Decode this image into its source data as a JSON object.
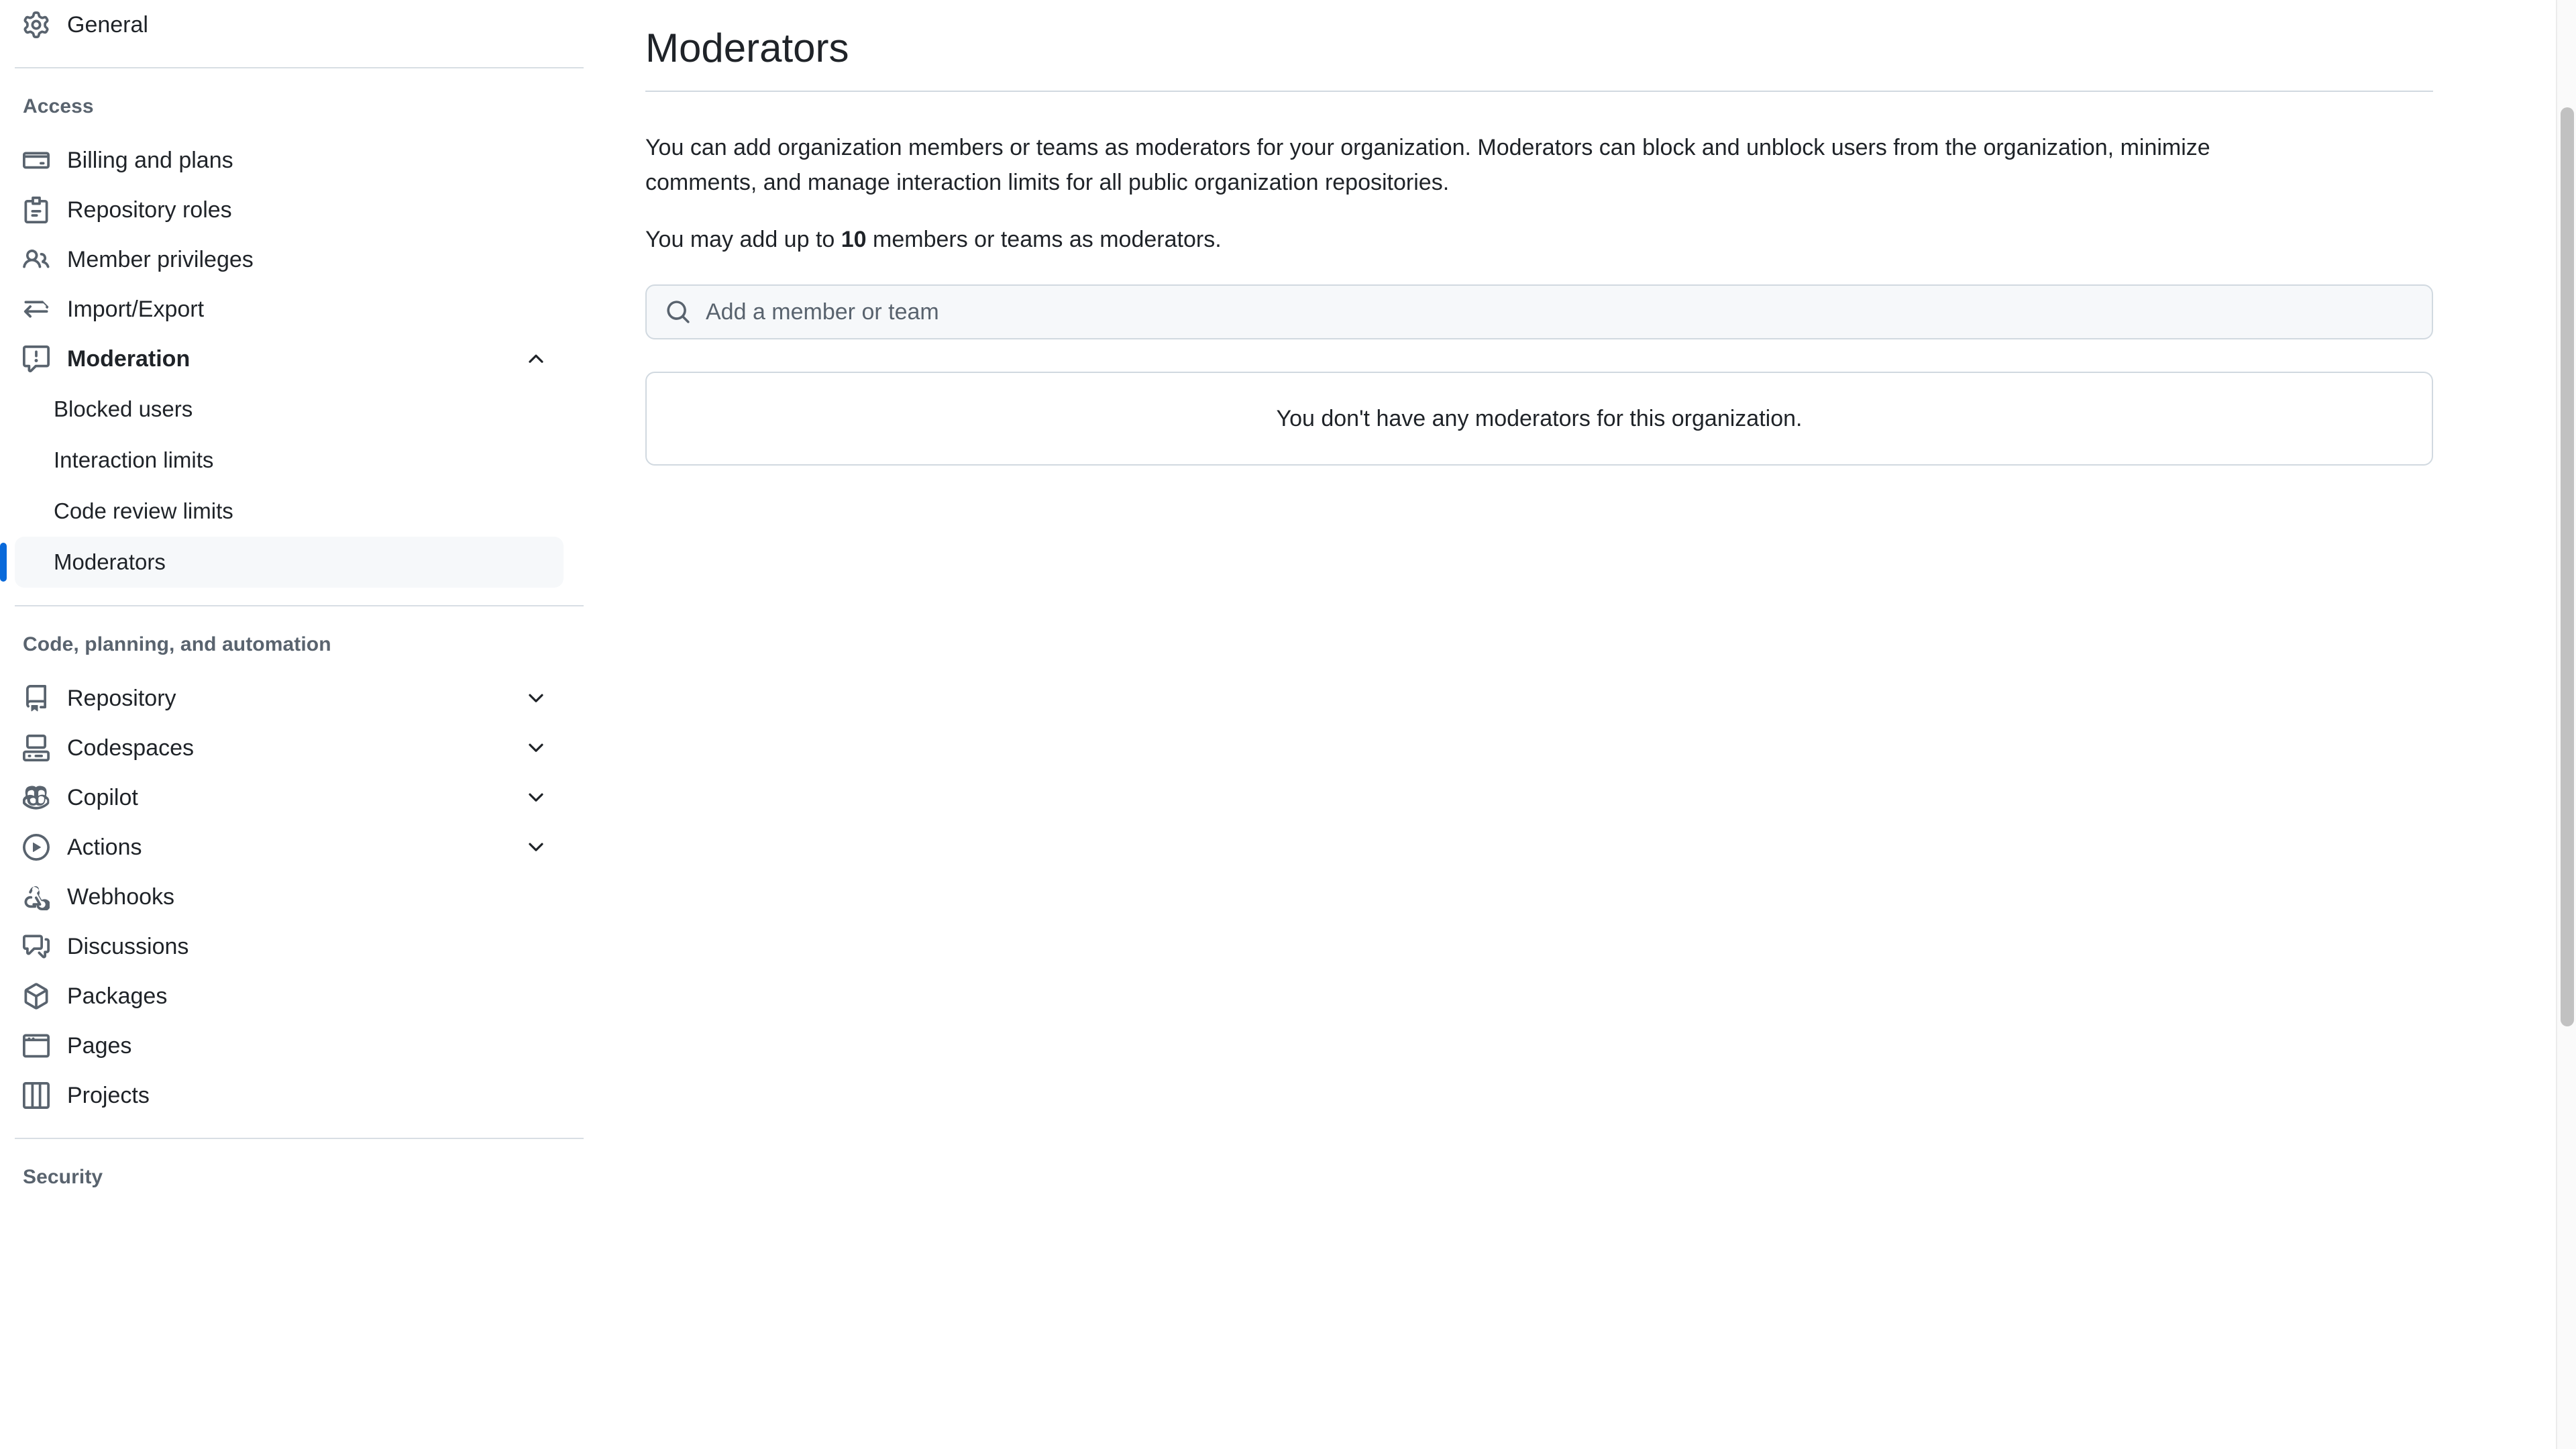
{
  "sidebar": {
    "top_items": [
      {
        "label": "General",
        "icon": "gear-icon",
        "name": "general"
      }
    ],
    "sections": [
      {
        "title": "Access",
        "name": "access",
        "items": [
          {
            "label": "Billing and plans",
            "icon": "credit-card-icon",
            "name": "billing-and-plans",
            "expandable": false,
            "bold": false
          },
          {
            "label": "Repository roles",
            "icon": "id-badge-icon",
            "name": "repository-roles",
            "expandable": false,
            "bold": false
          },
          {
            "label": "Member privileges",
            "icon": "people-icon",
            "name": "member-privileges",
            "expandable": false,
            "bold": false
          },
          {
            "label": "Import/Export",
            "icon": "arrow-switch-icon",
            "name": "import-export",
            "expandable": false,
            "bold": false
          },
          {
            "label": "Moderation",
            "icon": "report-icon",
            "name": "moderation",
            "expandable": true,
            "expanded": true,
            "bold": true,
            "sub_items": [
              {
                "label": "Blocked users",
                "name": "blocked-users",
                "selected": false
              },
              {
                "label": "Interaction limits",
                "name": "interaction-limits",
                "selected": false
              },
              {
                "label": "Code review limits",
                "name": "code-review-limits",
                "selected": false
              },
              {
                "label": "Moderators",
                "name": "moderators",
                "selected": true
              }
            ]
          }
        ]
      },
      {
        "title": "Code, planning, and automation",
        "name": "code-planning-and-automation",
        "items": [
          {
            "label": "Repository",
            "icon": "repo-icon",
            "name": "repository",
            "expandable": true,
            "expanded": false,
            "bold": false
          },
          {
            "label": "Codespaces",
            "icon": "codespaces-icon",
            "name": "codespaces",
            "expandable": true,
            "expanded": false,
            "bold": false
          },
          {
            "label": "Copilot",
            "icon": "copilot-icon",
            "name": "copilot",
            "expandable": true,
            "expanded": false,
            "bold": false
          },
          {
            "label": "Actions",
            "icon": "play-icon",
            "name": "actions",
            "expandable": true,
            "expanded": false,
            "bold": false
          },
          {
            "label": "Webhooks",
            "icon": "webhook-icon",
            "name": "webhooks",
            "expandable": false,
            "bold": false
          },
          {
            "label": "Discussions",
            "icon": "comment-discussion-icon",
            "name": "discussions",
            "expandable": false,
            "bold": false
          },
          {
            "label": "Packages",
            "icon": "package-icon",
            "name": "packages",
            "expandable": false,
            "bold": false
          },
          {
            "label": "Pages",
            "icon": "browser-icon",
            "name": "pages",
            "expandable": false,
            "bold": false
          },
          {
            "label": "Projects",
            "icon": "project-icon",
            "name": "projects",
            "expandable": false,
            "bold": false
          }
        ]
      },
      {
        "title": "Security",
        "name": "security",
        "items": []
      }
    ]
  },
  "main": {
    "title": "Moderators",
    "description": "You can add organization members or teams as moderators for your organization. Moderators can block and unblock users from the organization, minimize comments, and manage interaction limits for all public organization repositories.",
    "limit_prefix": "You may add up to ",
    "limit_count": "10",
    "limit_suffix": " members or teams as moderators.",
    "search": {
      "placeholder": "Add a member or team",
      "value": "",
      "icon": "search-icon"
    },
    "empty_state": "You don't have any moderators for this organization."
  },
  "colors": {
    "accent": "#0969da",
    "selected_bg": "#f6f8fa",
    "border": "#d1d9e0",
    "muted_text": "#59636e",
    "text": "#1f2328",
    "scrollbar_thumb": "#c1c1c1"
  }
}
